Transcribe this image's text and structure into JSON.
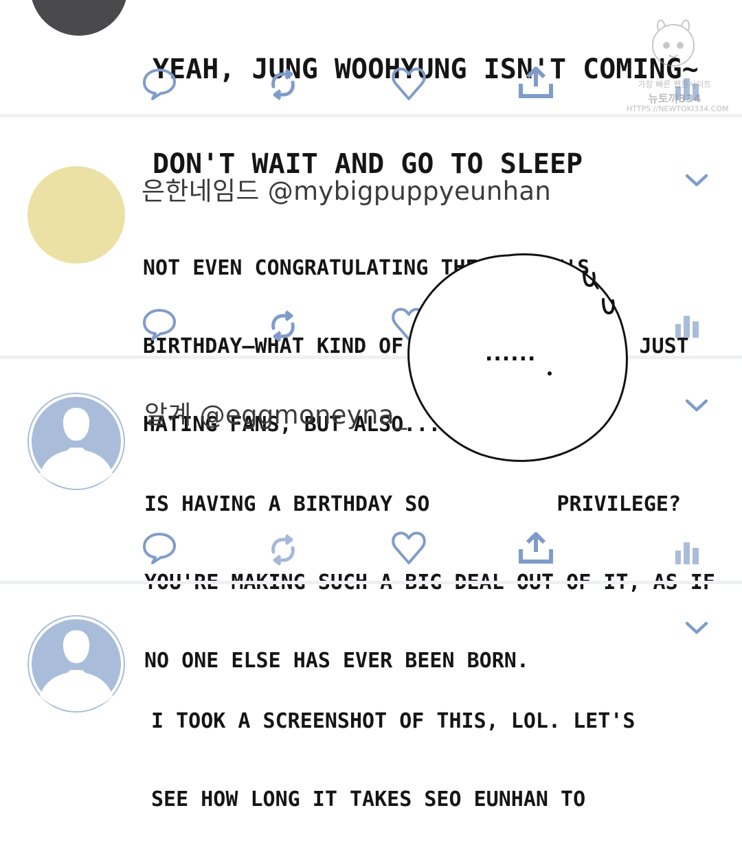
{
  "colors": {
    "icon_blue": "#7f9cc9",
    "divider": "#eef0f3"
  },
  "posts": [
    {
      "avatar": "dark-circle",
      "body_lines": [
        "YEAH, JUNG WOOHYUNG ISN'T COMING~",
        "DON'T WAIT AND GO TO SLEEP"
      ]
    },
    {
      "avatar": "yellow-circle",
      "display_name": "은한네임드",
      "handle": "@mybigpuppyeunhan",
      "body_lines": [
        "NOT EVEN CONGRATULATING THE MAKNAE'S",
        "BIRTHDAY—WHAT KIND OF IDOL IS THIS? NOT JUST",
        "HATING FANS, BUT ALSO..."
      ]
    },
    {
      "avatar": "default-user",
      "display_name": "알계",
      "handle": "@eggmoneyna_",
      "body_lines": [
        "IS HAVING A BIRTHDAY SO",
        "PRIVILEGE?",
        "YOU'RE MAKING SUCH A BIG DEAL OUT OF IT, AS IF",
        "NO ONE ELSE HAS EVER BEEN BORN."
      ]
    },
    {
      "avatar": "default-user",
      "body_lines": [
        "I TOOK A SCREENSHOT OF THIS, LOL. LET'S",
        "SEE HOW LONG IT TAKES SEO EUNHAN TO"
      ]
    }
  ],
  "bubble": {
    "text": "......",
    "sfx": "U U"
  },
  "watermark": {
    "line1": "가장 빠른 웹툰사이트",
    "line2": "뉴토끼334",
    "line3": "HTTPS://NEWTOKI334.COM"
  },
  "icons": [
    "comment-icon",
    "retweet-icon",
    "like-icon",
    "share-icon",
    "analytics-icon",
    "chevron-down-icon"
  ]
}
